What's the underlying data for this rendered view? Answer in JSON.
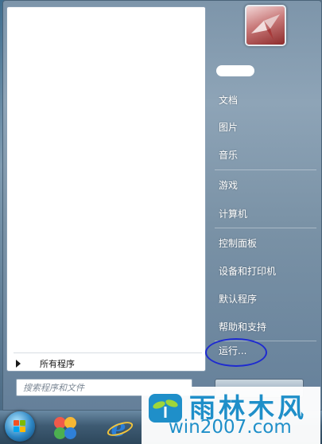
{
  "left_pane": {
    "all_programs_label": "所有程序",
    "search_placeholder": "搜索程序和文件"
  },
  "right_pane": {
    "items": [
      {
        "label": "文档"
      },
      {
        "label": "图片"
      },
      {
        "label": "音乐"
      },
      {
        "label": "游戏"
      },
      {
        "label": "计算机"
      },
      {
        "label": "控制面板"
      },
      {
        "label": "设备和打印机"
      },
      {
        "label": "默认程序"
      },
      {
        "label": "帮助和支持"
      },
      {
        "label": "运行..."
      }
    ]
  },
  "annotation": {
    "color": "#1e2bd0"
  },
  "taskbar": {
    "icons": [
      "start-orb",
      "app-icon",
      "internet-explorer-icon"
    ]
  },
  "watermark": {
    "title": "雨林木风",
    "site": "win2007.com"
  }
}
